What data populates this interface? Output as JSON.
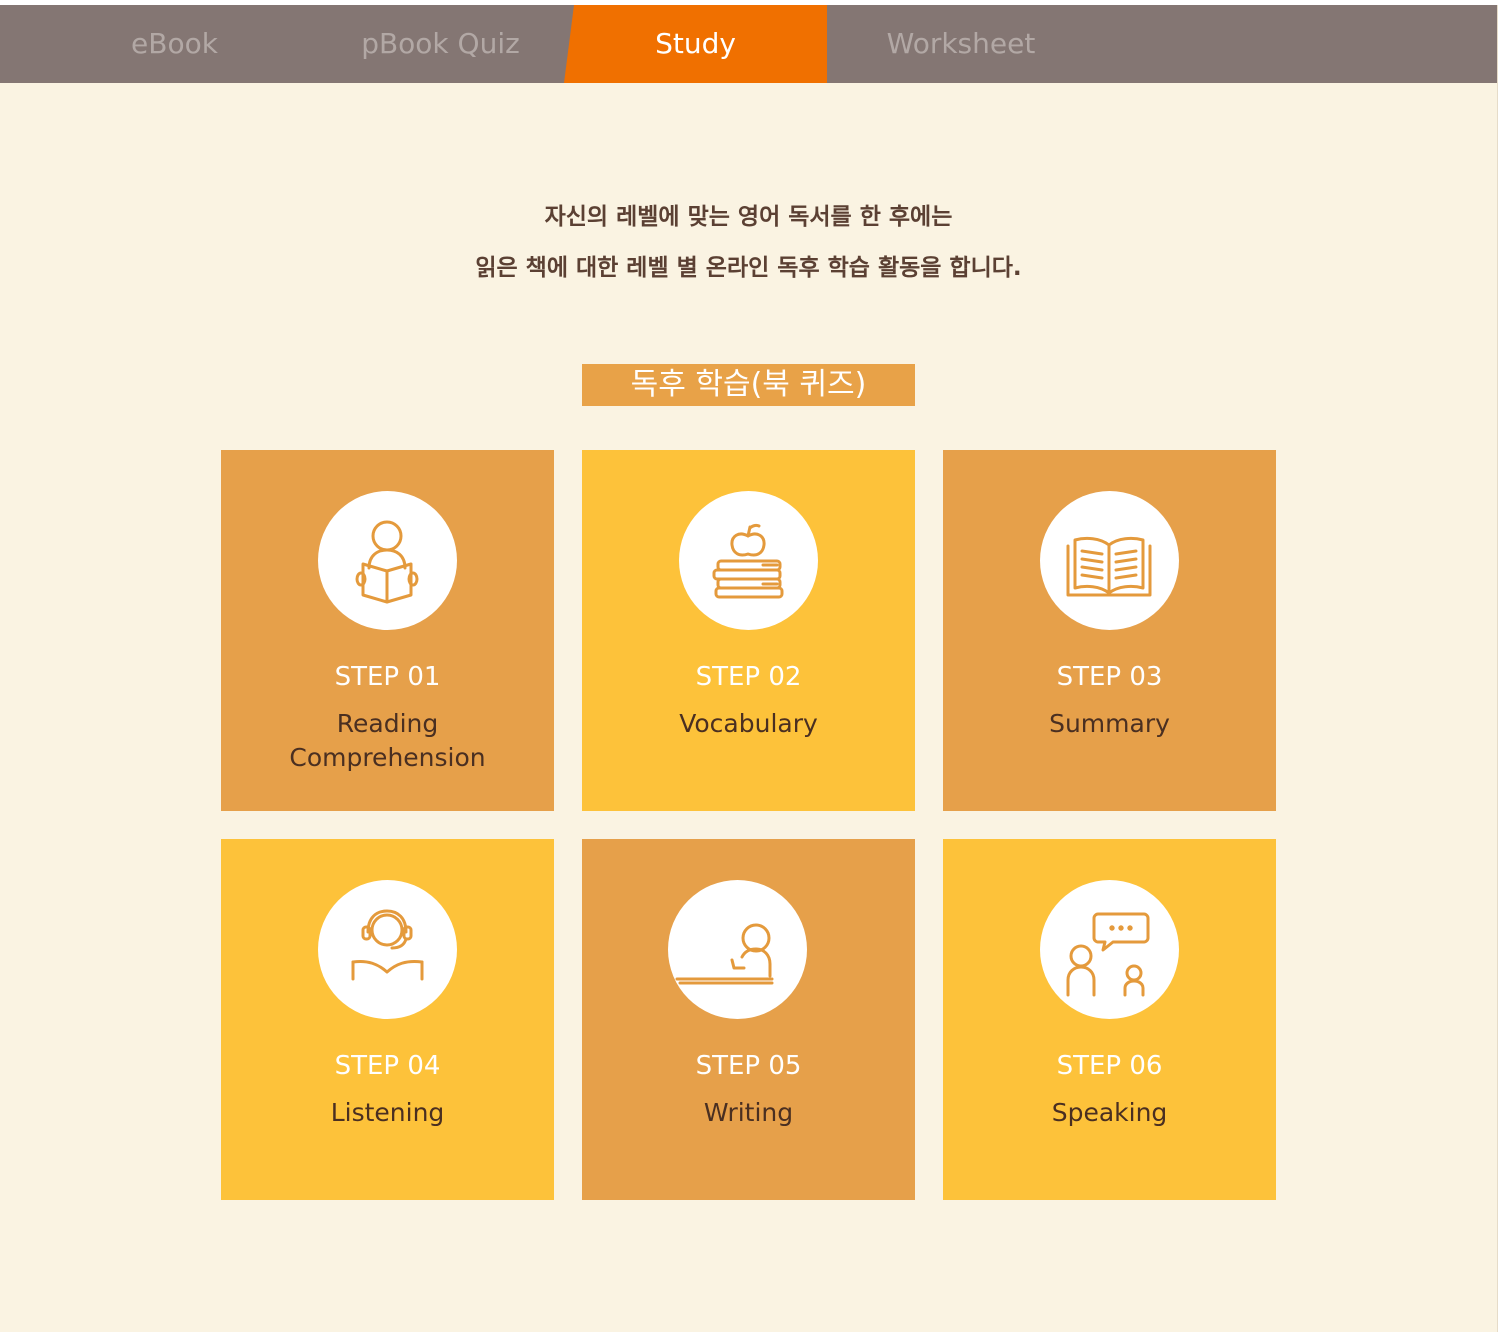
{
  "tabs": [
    {
      "label": "eBook",
      "active": false
    },
    {
      "label": "pBook Quiz",
      "active": false
    },
    {
      "label": "Study",
      "active": true
    },
    {
      "label": "Worksheet",
      "active": false
    }
  ],
  "intro": {
    "line1": "자신의 레벨에 맞는 영어 독서를 한 후에는",
    "line2": "읽은 책에 대한 레벨 별 온라인 독후 학습 활동을 합니다."
  },
  "section_label": "독후 학습(북 퀴즈)",
  "steps": [
    {
      "step": "STEP 01",
      "title_line1": "Reading",
      "title_line2": "Comprehension",
      "icon": "person-reading-book-icon"
    },
    {
      "step": "STEP 02",
      "title_line1": "Vocabulary",
      "title_line2": "",
      "icon": "books-with-apple-icon"
    },
    {
      "step": "STEP 03",
      "title_line1": "Summary",
      "title_line2": "",
      "icon": "open-book-icon"
    },
    {
      "step": "STEP 04",
      "title_line1": "Listening",
      "title_line2": "",
      "icon": "person-with-headphones-icon"
    },
    {
      "step": "STEP 05",
      "title_line1": "Writing",
      "title_line2": "",
      "icon": "person-writing-at-desk-icon"
    },
    {
      "step": "STEP 06",
      "title_line1": "Speaking",
      "title_line2": "",
      "icon": "people-talking-speech-bubble-icon"
    }
  ],
  "colors": {
    "tab_bar": "#847673",
    "tab_active": "#f07000",
    "background": "#faf3e2",
    "card_dark": "#e6a04a",
    "card_light": "#fdc23a",
    "icon_stroke": "#e49a3c"
  }
}
